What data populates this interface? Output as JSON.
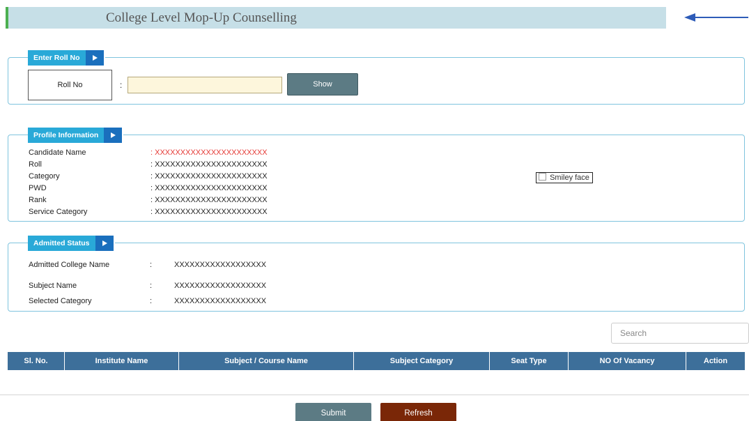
{
  "header": {
    "title": "College Level Mop-Up Counselling"
  },
  "roll_panel": {
    "legend": "Enter Roll No",
    "field_label": "Roll No",
    "colon": ":",
    "roll_value": "",
    "show_label": "Show"
  },
  "profile_panel": {
    "legend": "Profile Information",
    "rows": [
      {
        "label": "Candidate Name",
        "value": ": XXXXXXXXXXXXXXXXXXXXXX"
      },
      {
        "label": "Roll",
        "value": ": XXXXXXXXXXXXXXXXXXXXXX"
      },
      {
        "label": "Category",
        "value": ": XXXXXXXXXXXXXXXXXXXXXX"
      },
      {
        "label": "PWD",
        "value": ": XXXXXXXXXXXXXXXXXXXXXX"
      },
      {
        "label": "Rank",
        "value": ": XXXXXXXXXXXXXXXXXXXXXX"
      },
      {
        "label": "Service Category",
        "value": ": XXXXXXXXXXXXXXXXXXXXXX"
      }
    ],
    "photo_alt": "Smiley face",
    "highlight_color": "#e53935"
  },
  "admitted_panel": {
    "legend": "Admitted Status",
    "colon": ":",
    "rows": [
      {
        "label": "Admitted College Name",
        "value": "XXXXXXXXXXXXXXXXXX"
      },
      {
        "label": "Subject Name",
        "value": "XXXXXXXXXXXXXXXXXX"
      },
      {
        "label": "Selected Category",
        "value": "XXXXXXXXXXXXXXXXXX"
      }
    ]
  },
  "search": {
    "placeholder": "Search"
  },
  "table": {
    "columns": [
      "Sl. No.",
      "Institute Name",
      "Subject / Course Name",
      "Subject Category",
      "Seat Type",
      "NO Of Vacancy",
      "Action"
    ]
  },
  "actions": {
    "submit_label": "Submit",
    "refresh_label": "Refresh"
  },
  "colors": {
    "accent": "#29a9d8",
    "table_header": "#3d6f9a",
    "refresh": "#7a2707",
    "button": "#5c7b84"
  }
}
